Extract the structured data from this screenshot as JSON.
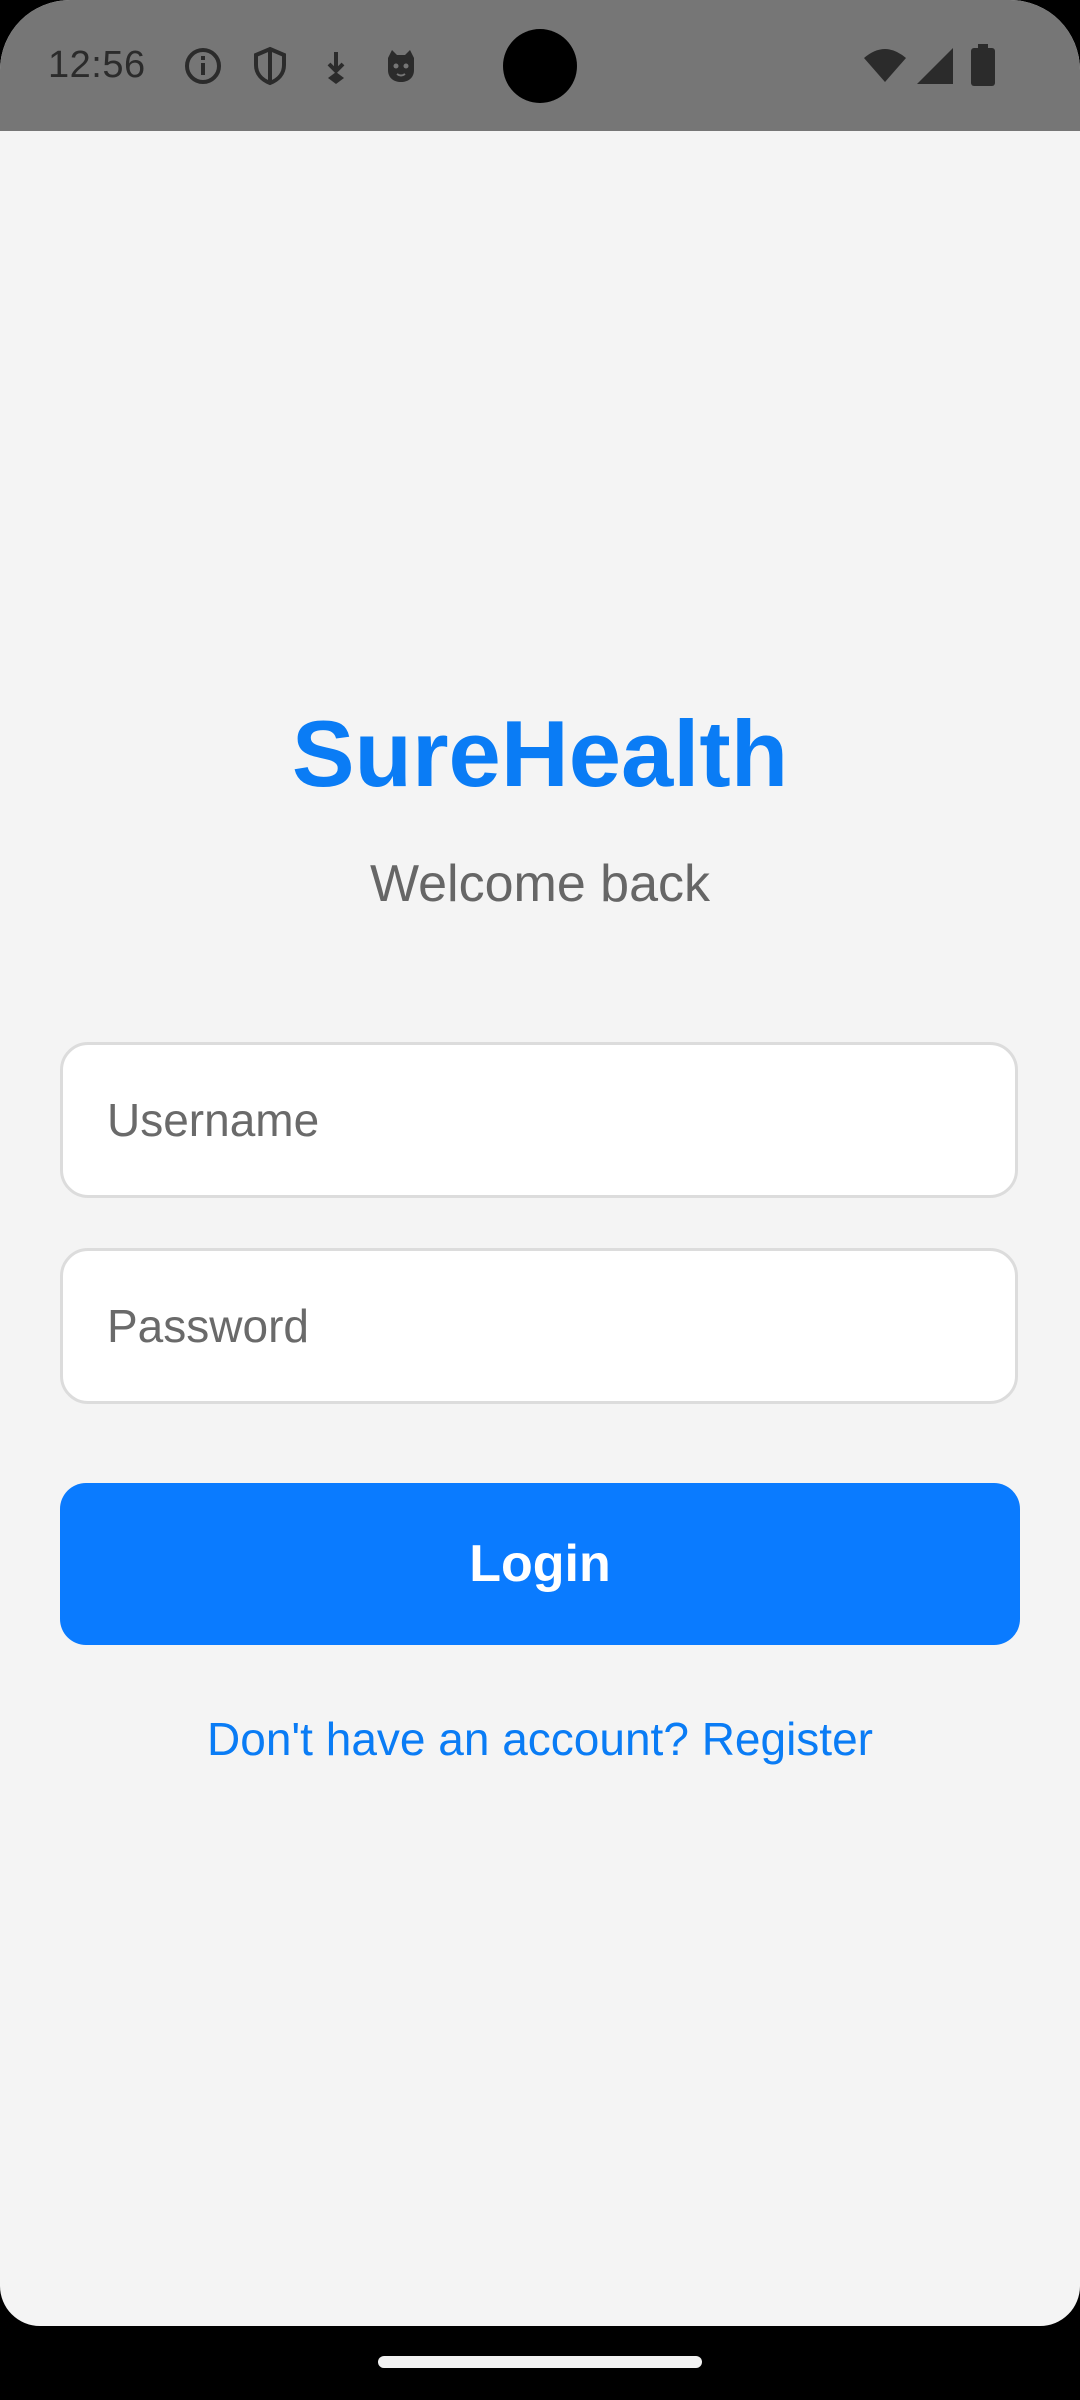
{
  "status_bar": {
    "time": "12:56",
    "icons_left": [
      "info-icon",
      "shield-icon",
      "download-icon",
      "cat-face-icon"
    ],
    "icons_right": [
      "wifi-icon",
      "signal-icon",
      "battery-icon"
    ],
    "background_color": "#767676"
  },
  "login": {
    "brand_title": "SureHealth",
    "subtitle": "Welcome back",
    "username_placeholder": "Username",
    "password_placeholder": "Password",
    "login_label": "Login",
    "register_link": "Don't have an account? Register",
    "accent_color": "#0a7bff"
  }
}
